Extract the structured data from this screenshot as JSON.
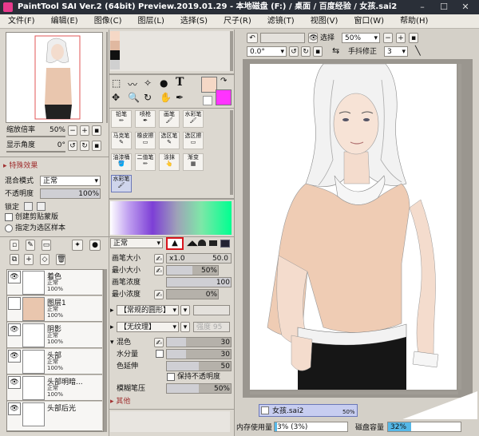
{
  "window": {
    "title": "PaintTool SAI Ver.2 (64bit) Preview.2019.01.29 - 本地磁盘 (F:) / 桌面 / 百度经验 / 女孩.sai2"
  },
  "menu": [
    "文件(F)",
    "编辑(E)",
    "图像(C)",
    "图层(L)",
    "选择(S)",
    "尺子(R)",
    "滤镜(T)",
    "视图(V)",
    "窗口(W)",
    "帮助(H)"
  ],
  "navigator": {
    "zoom_label": "缩放倍率",
    "zoom_value": "50%",
    "angle_label": "显示角度",
    "angle_value": "0°"
  },
  "effects": {
    "header": "特殊效果"
  },
  "blend": {
    "mode_label": "混合模式",
    "mode_value": "正常",
    "opacity_label": "不透明度",
    "opacity_value": "100%",
    "opacity_level": 1.0,
    "lock_label": "锁定",
    "clip_label": "创建剪贴蒙版",
    "sample_label": "指定为选区样本"
  },
  "layers": [
    {
      "name": "着色",
      "mode": "正常",
      "opacity": "100%"
    },
    {
      "name": "图层1",
      "mode": "正常",
      "opacity": "100%"
    },
    {
      "name": "阴影",
      "mode": "正常",
      "opacity": "100%"
    },
    {
      "name": "头部",
      "mode": "正常",
      "opacity": "100%"
    },
    {
      "name": "头部明暗...",
      "mode": "正常",
      "opacity": "100%"
    },
    {
      "name": "头部后光",
      "mode": "",
      "opacity": ""
    }
  ],
  "tools": {
    "grid": [
      [
        "铅笔",
        "喷枪",
        "画笔",
        "水彩笔"
      ],
      [
        "马克笔",
        "橡皮擦",
        "选区笔",
        "选区擦"
      ],
      [
        "油漆桶",
        "二值笔",
        "涂抹",
        "渐变"
      ],
      [
        "水彩笔"
      ]
    ],
    "colors": {
      "fg": "#f5d8c6",
      "bg": "#ff33ff"
    }
  },
  "brush": {
    "mode_value": "正常",
    "size_label": "画笔大小",
    "size_mult": "x1.0",
    "size_value": "50.0",
    "min_size_label": "最小大小",
    "min_size_value": "50%",
    "min_size_level": 0.5,
    "density_label": "画笔浓度",
    "density_value": "100",
    "density_level": 1.0,
    "min_density_label": "最小浓度",
    "min_density_value": "0%",
    "min_density_level": 0,
    "shape_value": "【常规的圆形】",
    "texture_value": "【无纹理】",
    "texture_strength": "强度 95",
    "mix_label": "混色",
    "mix_value": "30",
    "mix_level": 0.3,
    "water_label": "水分量",
    "water_value": "30",
    "water_level": 0.3,
    "extend_label": "色延伸",
    "extend_value": "50",
    "extend_level": 0.5,
    "keep_opacity_label": "保持不透明度",
    "blur_label": "模糊笔压",
    "blur_value": "50%",
    "blur_level": 0.5,
    "other_label": "其他"
  },
  "canvas_toolbar": {
    "select_label": "选择",
    "zoom_value": "50%",
    "angle_value": "0.0°",
    "stabilizer_label": "手抖修正",
    "stabilizer_value": "3"
  },
  "tabs": [
    {
      "name": "女孩.sai2",
      "percent": "50%"
    }
  ],
  "status": {
    "memory_label": "内存使用量",
    "memory_value": "3% (3%)",
    "memory_level": 0.03,
    "disk_label": "磁盘容量",
    "disk_value": "32%",
    "disk_level": 0.32
  }
}
